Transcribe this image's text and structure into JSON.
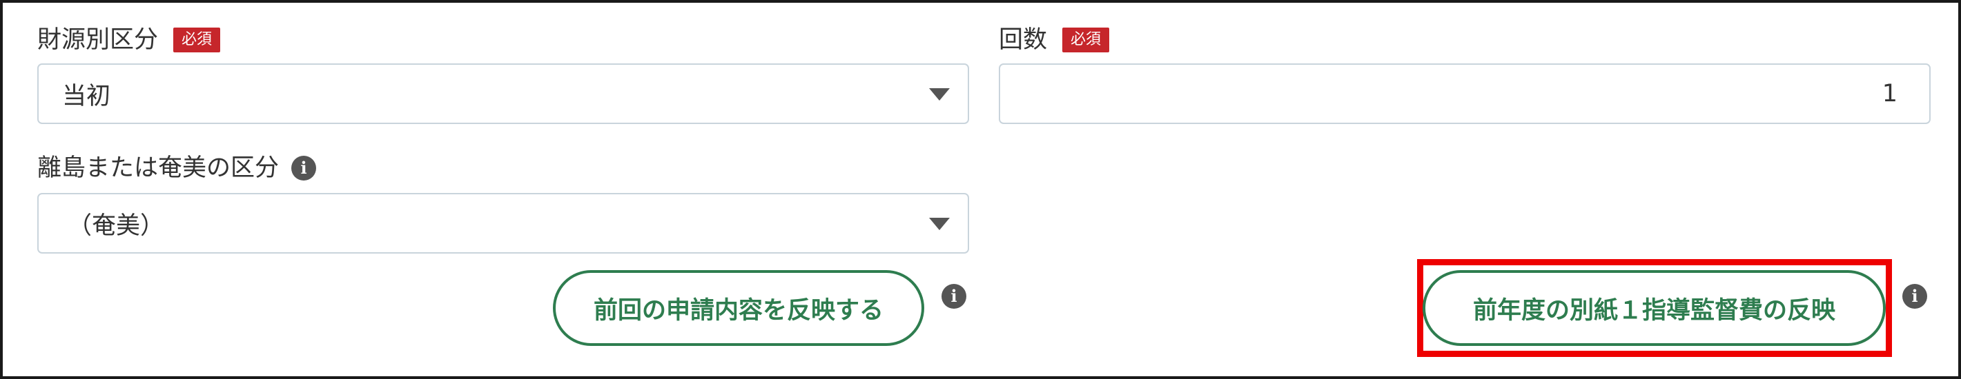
{
  "funding": {
    "label": "財源別区分",
    "required_badge": "必須",
    "value": "当初"
  },
  "count": {
    "label": "回数",
    "required_badge": "必須",
    "value": "1"
  },
  "island": {
    "label": "離島または奄美の区分",
    "value": "（奄美）"
  },
  "buttons": {
    "reflect_previous": "前回の申請内容を反映する",
    "reflect_last_year": "前年度の別紙１指導監督費の反映"
  },
  "icons": {
    "info": "i"
  },
  "colors": {
    "required_badge": "#c6262b",
    "button_green": "#2e7d4f",
    "highlight_red": "#ee0000",
    "frame": "#1a1a1a"
  }
}
